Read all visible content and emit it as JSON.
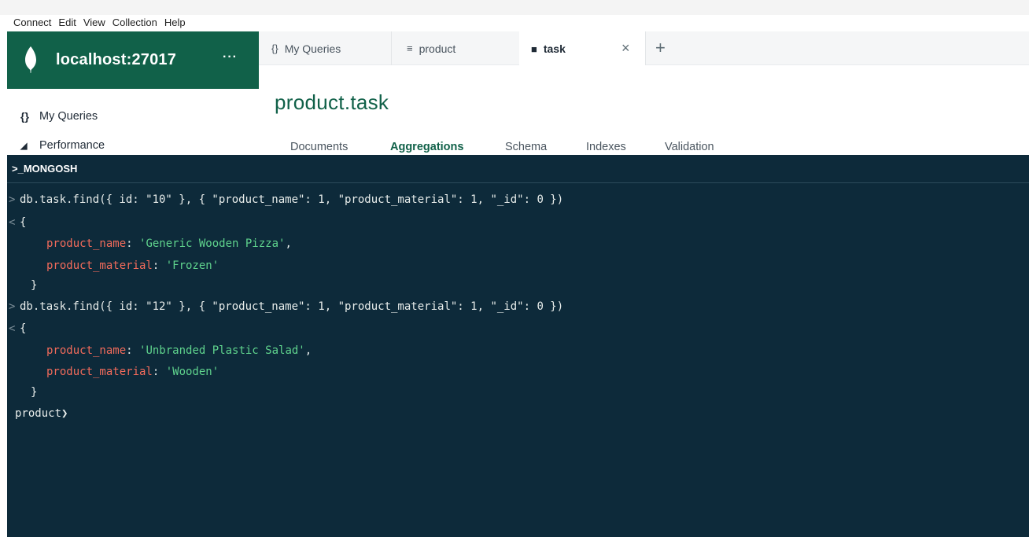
{
  "menubar": {
    "items": [
      "Connect",
      "Edit",
      "View",
      "Collection",
      "Help"
    ]
  },
  "sidebar": {
    "connection_name": "localhost:27017",
    "more_label": "···",
    "nav": [
      {
        "icon": "curly-braces-icon",
        "glyph": "{}",
        "label": "My Queries"
      },
      {
        "icon": "gauge-icon",
        "glyph": "◢",
        "label": "Performance"
      }
    ]
  },
  "tabs": [
    {
      "icon": "curly-braces-icon",
      "glyph": "{}",
      "label": "My Queries",
      "active": false
    },
    {
      "icon": "database-icon",
      "glyph": "≡",
      "label": "product",
      "active": false
    },
    {
      "icon": "folder-icon",
      "glyph": "■",
      "label": "task",
      "active": true
    }
  ],
  "tab_close": "×",
  "tab_add": "+",
  "namespace": {
    "title": "product.task"
  },
  "subtabs": [
    {
      "label": "Documents",
      "active": false
    },
    {
      "label": "Aggregations",
      "active": true
    },
    {
      "label": "Schema",
      "active": false
    },
    {
      "label": "Indexes",
      "active": false
    },
    {
      "label": "Validation",
      "active": false
    }
  ],
  "shell": {
    "title": ">_MONGOSH",
    "input_chevron": ">",
    "output_chevron": "<",
    "commands": [
      {
        "command": "db.task.find({ id: \"10\" }, { \"product_name\": 1, \"product_material\": 1, \"_id\": 0 })",
        "open_brace": "{",
        "close_brace": "}",
        "fields": [
          {
            "key": "product_name",
            "value": "'Generic Wooden Pizza'"
          },
          {
            "key": "product_material",
            "value": "'Frozen'"
          }
        ]
      },
      {
        "command": "db.task.find({ id: \"12\" }, { \"product_name\": 1, \"product_material\": 1, \"_id\": 0 })",
        "open_brace": "{",
        "close_brace": "}",
        "fields": [
          {
            "key": "product_name",
            "value": "'Unbranded Plastic Salad'"
          },
          {
            "key": "product_material",
            "value": "'Wooden'"
          }
        ]
      }
    ],
    "prompt": "product",
    "prompt_caret": "❯"
  },
  "colors": {
    "brand_green": "#116149",
    "shell_bg": "#0d2a3a",
    "key_color": "#f26b5b",
    "string_color": "#5fd38d"
  }
}
